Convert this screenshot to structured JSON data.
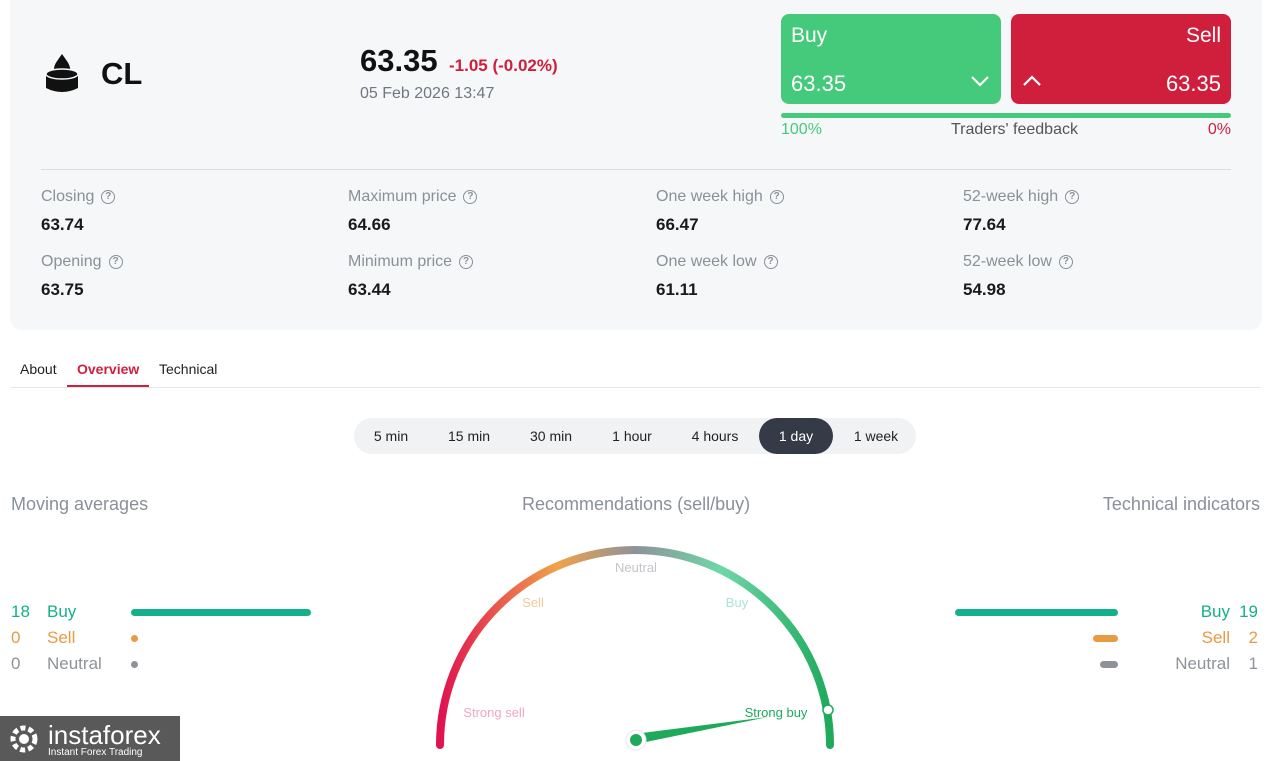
{
  "instrument": {
    "symbol": "CL",
    "price": "63.35",
    "change": "-1.05 (-0.02%)",
    "datetime": "05 Feb 2026 13:47",
    "icon": "oil-drop-icon"
  },
  "trade": {
    "buy_label": "Buy",
    "buy_price": "63.35",
    "sell_label": "Sell",
    "sell_price": "63.35",
    "buy_color": "#45c97a",
    "sell_color": "#cf1f3c"
  },
  "feedback": {
    "buy_percent": "100%",
    "label": "Traders' feedback",
    "sell_percent": "0%",
    "buy_fraction": 1.0
  },
  "stats": [
    {
      "label": "Closing",
      "value": "63.74"
    },
    {
      "label": "Maximum price",
      "value": "64.66"
    },
    {
      "label": "One week high",
      "value": "66.47"
    },
    {
      "label": "52-week high",
      "value": "77.64"
    },
    {
      "label": "Opening",
      "value": "63.75"
    },
    {
      "label": "Minimum price",
      "value": "63.44"
    },
    {
      "label": "One week low",
      "value": "61.11"
    },
    {
      "label": "52-week low",
      "value": "54.98"
    }
  ],
  "tabs": [
    {
      "label": "About",
      "active": false
    },
    {
      "label": "Overview",
      "active": true
    },
    {
      "label": "Technical",
      "active": false
    }
  ],
  "periods": [
    {
      "label": "5 min",
      "active": false
    },
    {
      "label": "15 min",
      "active": false
    },
    {
      "label": "30 min",
      "active": false
    },
    {
      "label": "1 hour",
      "active": false
    },
    {
      "label": "4 hours",
      "active": false
    },
    {
      "label": "1 day",
      "active": true
    },
    {
      "label": "1 week",
      "active": false
    }
  ],
  "moving_averages": {
    "title": "Moving averages",
    "rows": [
      {
        "count": "18",
        "label": "Buy"
      },
      {
        "count": "0",
        "label": "Sell"
      },
      {
        "count": "0",
        "label": "Neutral"
      }
    ]
  },
  "recommendations": {
    "title": "Recommendations (sell/buy)",
    "labels": {
      "neutral": "Neutral",
      "sell": "Sell",
      "buy": "Buy",
      "strong_sell": "Strong sell",
      "strong_buy": "Strong buy"
    },
    "current": "Strong buy"
  },
  "technical_indicators": {
    "title": "Technical indicators",
    "rows": [
      {
        "count": "19",
        "label": "Buy"
      },
      {
        "count": "2",
        "label": "Sell"
      },
      {
        "count": "1",
        "label": "Neutral"
      }
    ]
  },
  "watermark": {
    "brand": "instaforex",
    "tagline": "Instant Forex Trading"
  }
}
